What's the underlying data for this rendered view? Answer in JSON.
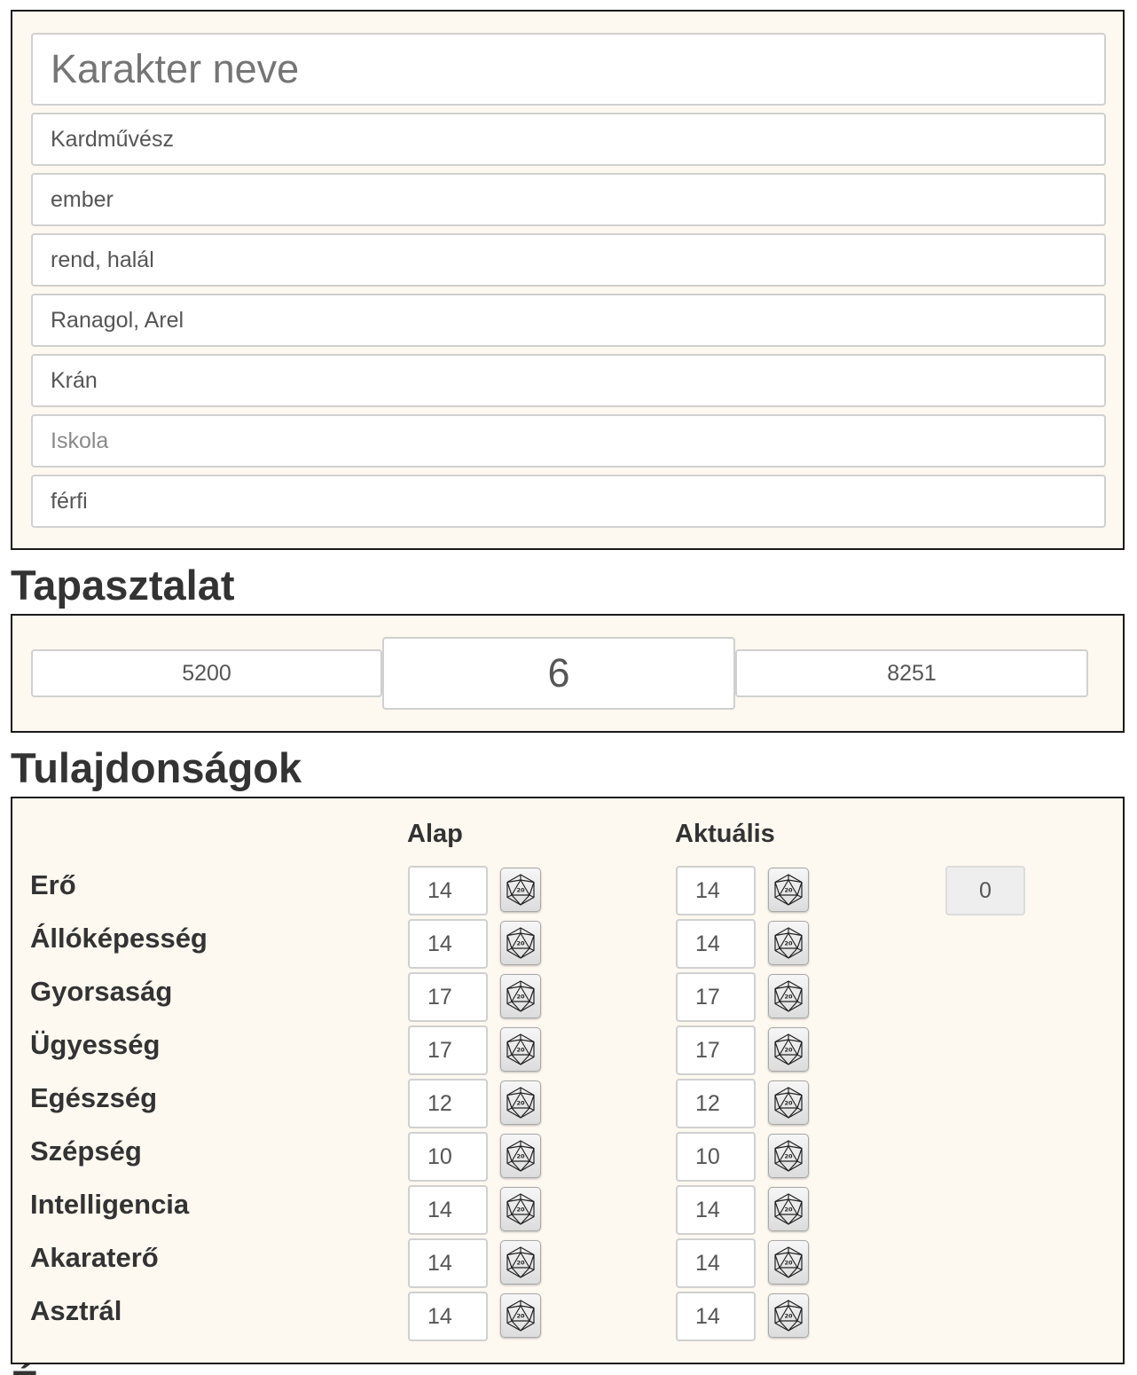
{
  "identity": {
    "name_placeholder": "Karakter neve",
    "class_value": "Kardművész",
    "race_value": "ember",
    "alignment_value": "rend, halál",
    "religion_value": "Ranagol, Arel",
    "homeland_value": "Krán",
    "school_placeholder": "Iskola",
    "gender_value": "férfi"
  },
  "experience": {
    "heading": "Tapasztalat",
    "current_xp": "5200",
    "level": "6",
    "next_level_xp": "8251"
  },
  "attributes": {
    "heading": "Tulajdonságok",
    "col_base": "Alap",
    "col_current": "Aktuális",
    "extra_value": "0",
    "dice_icon": "d20-icon",
    "rows": [
      {
        "label": "Erő",
        "base": "14",
        "current": "14"
      },
      {
        "label": "Állóképesség",
        "base": "14",
        "current": "14"
      },
      {
        "label": "Gyorsaság",
        "base": "17",
        "current": "17"
      },
      {
        "label": "Ügyesség",
        "base": "17",
        "current": "17"
      },
      {
        "label": "Egészség",
        "base": "12",
        "current": "12"
      },
      {
        "label": "Szépség",
        "base": "10",
        "current": "10"
      },
      {
        "label": "Intelligencia",
        "base": "14",
        "current": "14"
      },
      {
        "label": "Akaraterő",
        "base": "14",
        "current": "14"
      },
      {
        "label": "Asztrál",
        "base": "14",
        "current": "14"
      }
    ]
  },
  "next_section": {
    "heading": "É"
  }
}
